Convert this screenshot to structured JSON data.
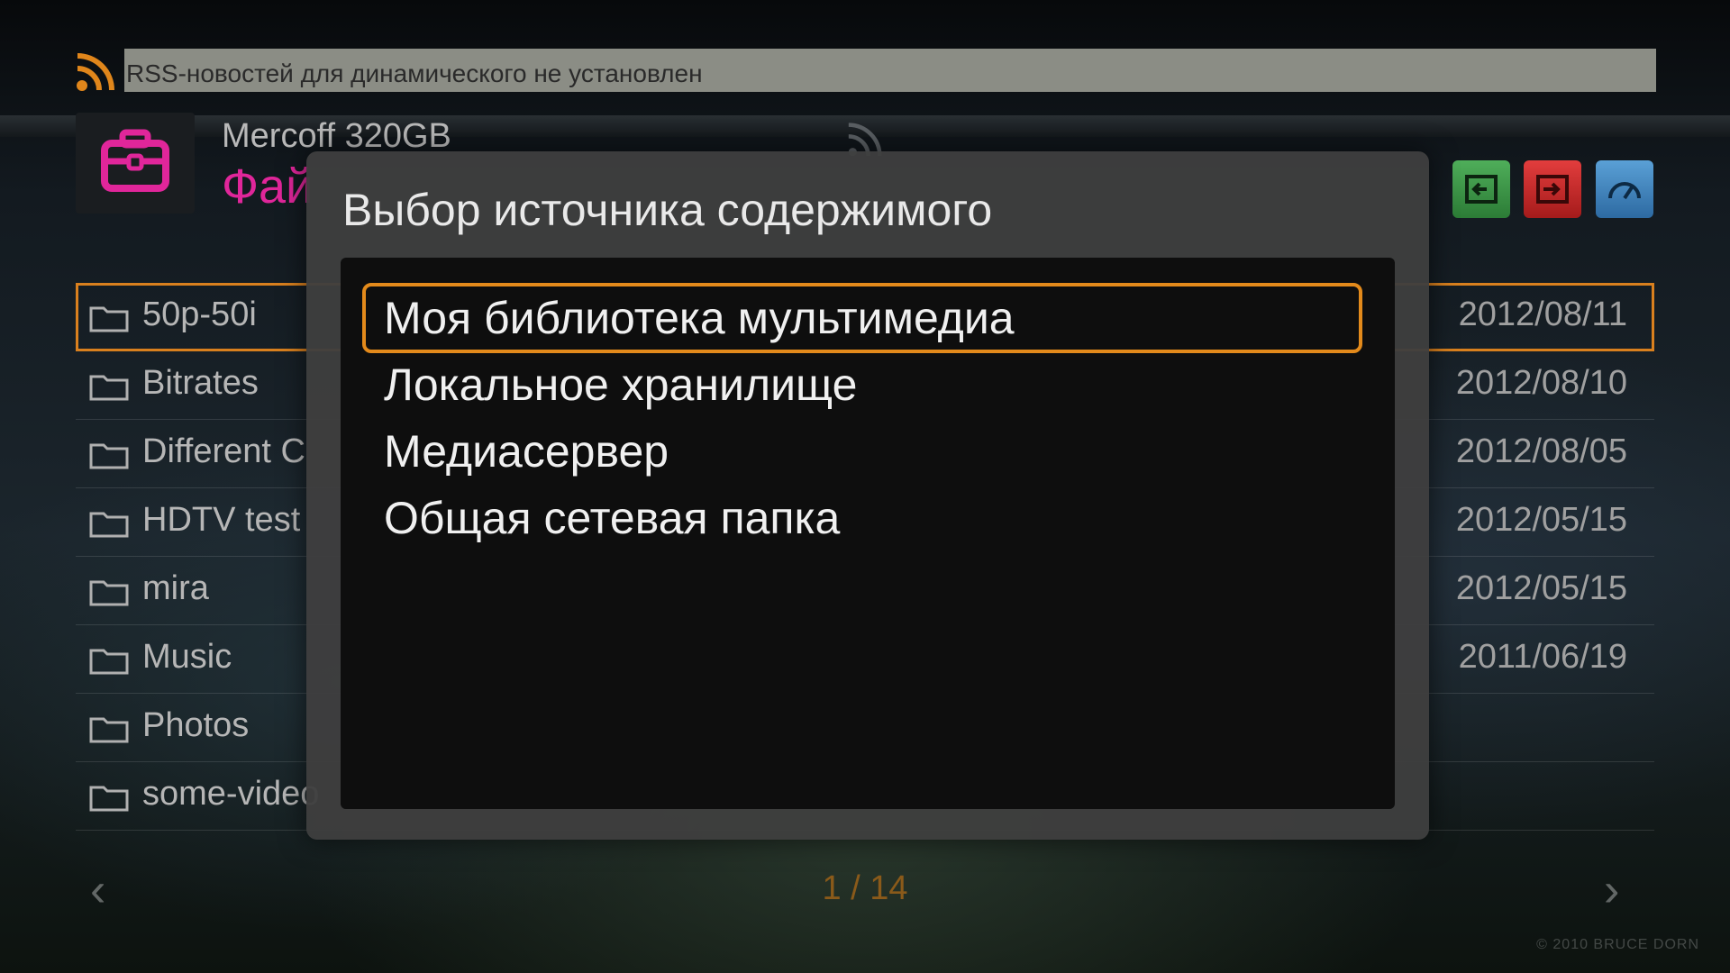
{
  "rss": {
    "message": "RSS-новостей для динамического не установлен",
    "icon": "rss-icon",
    "color": "#e0861b"
  },
  "header": {
    "device": "Mercoff 320GB",
    "section": "Фай",
    "section_color": "#e0269a",
    "tool_icon": "toolbox-icon",
    "buttons": [
      {
        "name": "green-button",
        "icon": "input-icon",
        "color": "#3d9a47"
      },
      {
        "name": "red-button",
        "icon": "exit-icon",
        "color": "#c62b2b"
      },
      {
        "name": "blue-button",
        "icon": "speedometer-icon",
        "color": "#3f82bd"
      }
    ]
  },
  "file_list": {
    "items": [
      {
        "name": "50p-50i",
        "date": "2012/08/11"
      },
      {
        "name": "Bitrates",
        "date": "2012/08/10"
      },
      {
        "name": "Different C",
        "date": "2012/08/05"
      },
      {
        "name": "HDTV test",
        "date": "2012/05/15"
      },
      {
        "name": "mira",
        "date": "2012/05/15"
      },
      {
        "name": "Music",
        "date": "2011/06/19"
      },
      {
        "name": "Photos",
        "date": ""
      },
      {
        "name": "some-video",
        "date": ""
      }
    ],
    "selected_index": 0
  },
  "pager": {
    "text": "1 / 14"
  },
  "copyright": "© 2010  BRUCE DORN",
  "dialog": {
    "title": "Выбор источника содержимого",
    "options": [
      "Моя библиотека мультимедиа",
      "Локальное хранилище",
      "Медиасервер",
      "Общая сетевая папка"
    ],
    "selected_index": 0,
    "highlight_color": "#e38a1b"
  }
}
